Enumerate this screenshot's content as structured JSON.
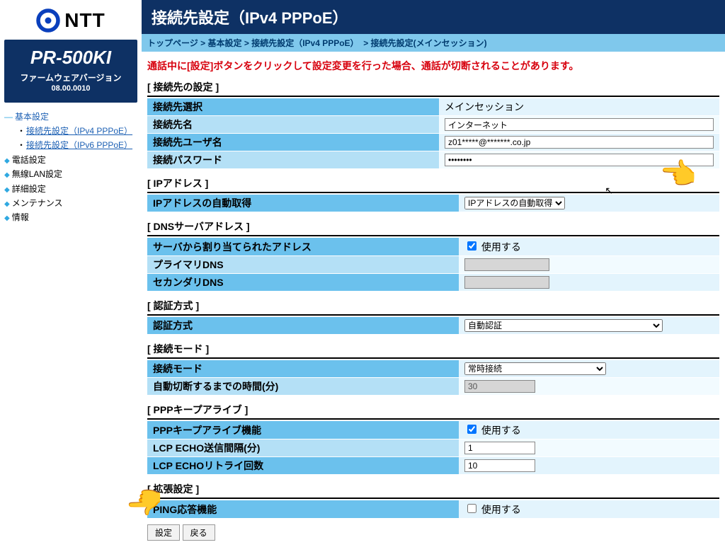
{
  "branding": {
    "company": "NTT",
    "model": "PR-500KI",
    "firmware_label": "ファームウェアバージョン",
    "firmware_version": "08.00.0010"
  },
  "nav": {
    "basic": "基本設定",
    "ipv4": "接続先設定（IPv4 PPPoE）",
    "ipv6": "接続先設定（IPv6 PPPoE）",
    "phone": "電話設定",
    "wlan": "無線LAN設定",
    "detail": "詳細設定",
    "maint": "メンテナンス",
    "info": "情報"
  },
  "title": "接続先設定（IPv4 PPPoE）",
  "breadcrumb": {
    "top": "トップページ",
    "basic": "基本設定",
    "ipv4": "接続先設定（IPv4 PPPoE）",
    "current": "接続先設定(メインセッション)",
    "sep": ">"
  },
  "warning": "通話中に[設定]ボタンをクリックして設定変更を行った場合、通話が切断されることがあります。",
  "sections": {
    "conn": "[ 接続先の設定 ]",
    "ip": "[ IPアドレス ]",
    "dns": "[ DNSサーバアドレス ]",
    "auth": "[ 認証方式 ]",
    "mode": "[ 接続モード ]",
    "ppp": "[ PPPキープアライブ ]",
    "ext": "[ 拡張設定 ]"
  },
  "conn": {
    "select_lbl": "接続先選択",
    "select_val": "メインセッション",
    "name_lbl": "接続先名",
    "name_val": "インターネット",
    "user_lbl": "接続先ユーザ名",
    "user_val": "z01*****@*******.co.jp",
    "pass_lbl": "接続パスワード",
    "pass_val": "********"
  },
  "ip": {
    "auto_lbl": "IPアドレスの自動取得",
    "auto_val": "IPアドレスの自動取得"
  },
  "dns": {
    "assigned_lbl": "サーバから割り当てられたアドレス",
    "use_label": "使用する",
    "assigned_checked": true,
    "primary_lbl": "プライマリDNS",
    "primary_val": "",
    "secondary_lbl": "セカンダリDNS",
    "secondary_val": ""
  },
  "auth": {
    "method_lbl": "認証方式",
    "method_val": "自動認証"
  },
  "mode": {
    "mode_lbl": "接続モード",
    "mode_val": "常時接続",
    "idle_lbl": "自動切断するまでの時間(分)",
    "idle_val": "30"
  },
  "ppp": {
    "func_lbl": "PPPキープアライブ機能",
    "use_label": "使用する",
    "func_checked": true,
    "echo_int_lbl": "LCP ECHO送信間隔(分)",
    "echo_int_val": "1",
    "echo_retry_lbl": "LCP ECHOリトライ回数",
    "echo_retry_val": "10"
  },
  "ext": {
    "ping_lbl": "PING応答機能",
    "use_label": "使用する",
    "ping_checked": false
  },
  "buttons": {
    "apply": "設定",
    "back": "戻る"
  }
}
